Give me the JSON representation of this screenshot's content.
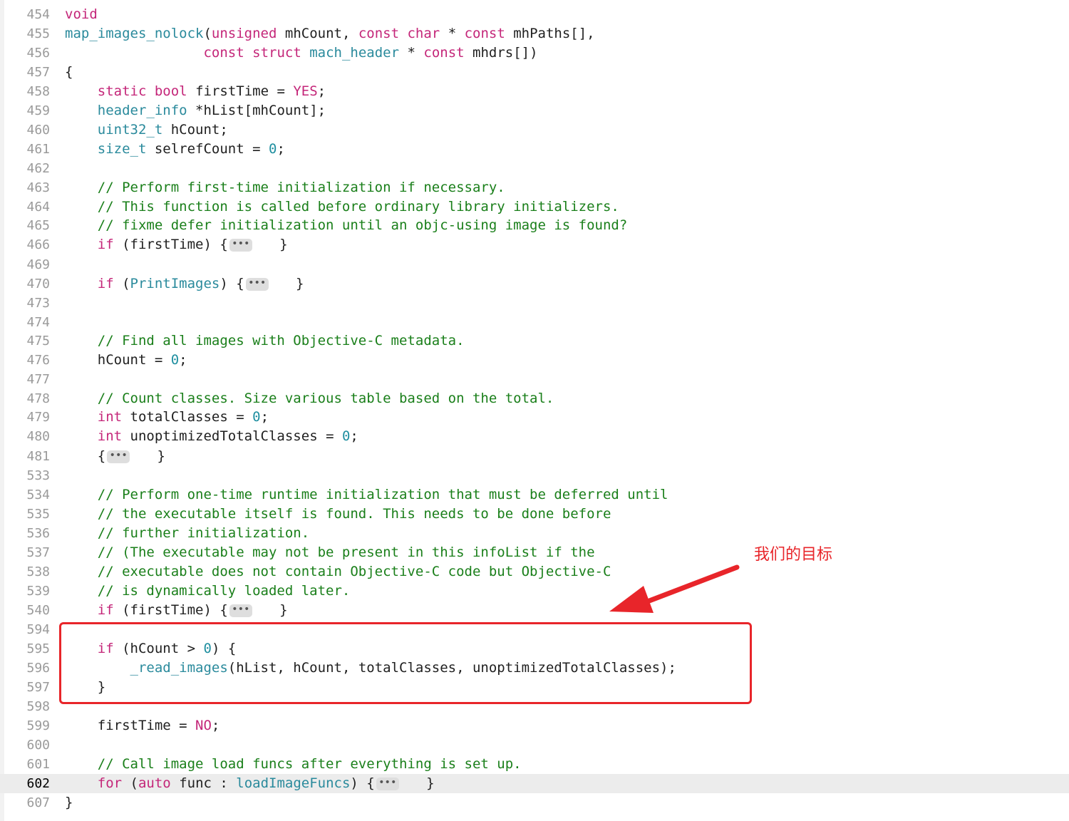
{
  "editor": {
    "current_line": "602",
    "lines": [
      {
        "ln": "454",
        "tokens": [
          {
            "t": "void",
            "c": "kw"
          }
        ]
      },
      {
        "ln": "455",
        "tokens": [
          {
            "t": "map_images_nolock",
            "c": "ty"
          },
          {
            "t": "(",
            "c": "pl"
          },
          {
            "t": "unsigned",
            "c": "kw"
          },
          {
            "t": " mhCount, ",
            "c": "pl"
          },
          {
            "t": "const",
            "c": "kw"
          },
          {
            "t": " ",
            "c": "pl"
          },
          {
            "t": "char",
            "c": "kw"
          },
          {
            "t": " * ",
            "c": "pl"
          },
          {
            "t": "const",
            "c": "kw"
          },
          {
            "t": " mhPaths[],",
            "c": "pl"
          }
        ]
      },
      {
        "ln": "456",
        "tokens": [
          {
            "t": "                 ",
            "c": "pl"
          },
          {
            "t": "const",
            "c": "kw"
          },
          {
            "t": " ",
            "c": "pl"
          },
          {
            "t": "struct",
            "c": "kw"
          },
          {
            "t": " ",
            "c": "pl"
          },
          {
            "t": "mach_header",
            "c": "ty"
          },
          {
            "t": " * ",
            "c": "pl"
          },
          {
            "t": "const",
            "c": "kw"
          },
          {
            "t": " mhdrs[])",
            "c": "pl"
          }
        ]
      },
      {
        "ln": "457",
        "tokens": [
          {
            "t": "{",
            "c": "pl"
          }
        ]
      },
      {
        "ln": "458",
        "tokens": [
          {
            "t": "    ",
            "c": "pl"
          },
          {
            "t": "static",
            "c": "kw"
          },
          {
            "t": " ",
            "c": "pl"
          },
          {
            "t": "bool",
            "c": "kw"
          },
          {
            "t": " firstTime = ",
            "c": "pl"
          },
          {
            "t": "YES",
            "c": "kw"
          },
          {
            "t": ";",
            "c": "pl"
          }
        ]
      },
      {
        "ln": "459",
        "tokens": [
          {
            "t": "    ",
            "c": "pl"
          },
          {
            "t": "header_info",
            "c": "ty"
          },
          {
            "t": " *hList[mhCount];",
            "c": "pl"
          }
        ]
      },
      {
        "ln": "460",
        "tokens": [
          {
            "t": "    ",
            "c": "pl"
          },
          {
            "t": "uint32_t",
            "c": "ty"
          },
          {
            "t": " hCount;",
            "c": "pl"
          }
        ]
      },
      {
        "ln": "461",
        "tokens": [
          {
            "t": "    ",
            "c": "pl"
          },
          {
            "t": "size_t",
            "c": "ty"
          },
          {
            "t": " selrefCount = ",
            "c": "pl"
          },
          {
            "t": "0",
            "c": "num"
          },
          {
            "t": ";",
            "c": "pl"
          }
        ]
      },
      {
        "ln": "462",
        "tokens": []
      },
      {
        "ln": "463",
        "tokens": [
          {
            "t": "    // Perform first-time initialization if necessary.",
            "c": "cm"
          }
        ]
      },
      {
        "ln": "464",
        "tokens": [
          {
            "t": "    // This function is called before ordinary library initializers.",
            "c": "cm"
          }
        ]
      },
      {
        "ln": "465",
        "tokens": [
          {
            "t": "    // fixme defer initialization until an objc-using image is found?",
            "c": "cm"
          }
        ]
      },
      {
        "ln": "466",
        "tokens": [
          {
            "t": "    ",
            "c": "pl"
          },
          {
            "t": "if",
            "c": "kw"
          },
          {
            "t": " (firstTime) {",
            "c": "pl"
          },
          {
            "t": "•••",
            "c": "fold"
          },
          {
            "t": "   }",
            "c": "pl"
          }
        ]
      },
      {
        "ln": "469",
        "tokens": []
      },
      {
        "ln": "470",
        "tokens": [
          {
            "t": "    ",
            "c": "pl"
          },
          {
            "t": "if",
            "c": "kw"
          },
          {
            "t": " (",
            "c": "pl"
          },
          {
            "t": "PrintImages",
            "c": "ty"
          },
          {
            "t": ") {",
            "c": "pl"
          },
          {
            "t": "•••",
            "c": "fold"
          },
          {
            "t": "   }",
            "c": "pl"
          }
        ]
      },
      {
        "ln": "473",
        "tokens": []
      },
      {
        "ln": "474",
        "tokens": []
      },
      {
        "ln": "475",
        "tokens": [
          {
            "t": "    // Find all images with Objective-C metadata.",
            "c": "cm"
          }
        ]
      },
      {
        "ln": "476",
        "tokens": [
          {
            "t": "    hCount = ",
            "c": "pl"
          },
          {
            "t": "0",
            "c": "num"
          },
          {
            "t": ";",
            "c": "pl"
          }
        ]
      },
      {
        "ln": "477",
        "tokens": []
      },
      {
        "ln": "478",
        "tokens": [
          {
            "t": "    // Count classes. Size various table based on the total.",
            "c": "cm"
          }
        ]
      },
      {
        "ln": "479",
        "tokens": [
          {
            "t": "    ",
            "c": "pl"
          },
          {
            "t": "int",
            "c": "kw"
          },
          {
            "t": " totalClasses = ",
            "c": "pl"
          },
          {
            "t": "0",
            "c": "num"
          },
          {
            "t": ";",
            "c": "pl"
          }
        ]
      },
      {
        "ln": "480",
        "tokens": [
          {
            "t": "    ",
            "c": "pl"
          },
          {
            "t": "int",
            "c": "kw"
          },
          {
            "t": " unoptimizedTotalClasses = ",
            "c": "pl"
          },
          {
            "t": "0",
            "c": "num"
          },
          {
            "t": ";",
            "c": "pl"
          }
        ]
      },
      {
        "ln": "481",
        "tokens": [
          {
            "t": "    {",
            "c": "pl"
          },
          {
            "t": "•••",
            "c": "fold"
          },
          {
            "t": "   }",
            "c": "pl"
          }
        ]
      },
      {
        "ln": "533",
        "tokens": []
      },
      {
        "ln": "534",
        "tokens": [
          {
            "t": "    // Perform one-time runtime initialization that must be deferred until",
            "c": "cm"
          }
        ]
      },
      {
        "ln": "535",
        "tokens": [
          {
            "t": "    // the executable itself is found. This needs to be done before",
            "c": "cm"
          }
        ]
      },
      {
        "ln": "536",
        "tokens": [
          {
            "t": "    // further initialization.",
            "c": "cm"
          }
        ]
      },
      {
        "ln": "537",
        "tokens": [
          {
            "t": "    // (The executable may not be present in this infoList if the",
            "c": "cm"
          }
        ]
      },
      {
        "ln": "538",
        "tokens": [
          {
            "t": "    // executable does not contain Objective-C code but Objective-C",
            "c": "cm"
          }
        ]
      },
      {
        "ln": "539",
        "tokens": [
          {
            "t": "    // is dynamically loaded later.",
            "c": "cm"
          }
        ]
      },
      {
        "ln": "540",
        "tokens": [
          {
            "t": "    ",
            "c": "pl"
          },
          {
            "t": "if",
            "c": "kw"
          },
          {
            "t": " (firstTime) {",
            "c": "pl"
          },
          {
            "t": "•••",
            "c": "fold"
          },
          {
            "t": "   }",
            "c": "pl"
          }
        ]
      },
      {
        "ln": "594",
        "tokens": []
      },
      {
        "ln": "595",
        "tokens": [
          {
            "t": "    ",
            "c": "pl"
          },
          {
            "t": "if",
            "c": "kw"
          },
          {
            "t": " (hCount > ",
            "c": "pl"
          },
          {
            "t": "0",
            "c": "num"
          },
          {
            "t": ") {",
            "c": "pl"
          }
        ]
      },
      {
        "ln": "596",
        "tokens": [
          {
            "t": "        ",
            "c": "pl"
          },
          {
            "t": "_read_images",
            "c": "ty"
          },
          {
            "t": "(hList, hCount, totalClasses, unoptimizedTotalClasses);",
            "c": "pl"
          }
        ]
      },
      {
        "ln": "597",
        "tokens": [
          {
            "t": "    }",
            "c": "pl"
          }
        ]
      },
      {
        "ln": "598",
        "tokens": []
      },
      {
        "ln": "599",
        "tokens": [
          {
            "t": "    firstTime = ",
            "c": "pl"
          },
          {
            "t": "NO",
            "c": "kw"
          },
          {
            "t": ";",
            "c": "pl"
          }
        ]
      },
      {
        "ln": "600",
        "tokens": []
      },
      {
        "ln": "601",
        "tokens": [
          {
            "t": "    // Call image load funcs after everything is set up.",
            "c": "cm"
          }
        ]
      },
      {
        "ln": "602",
        "tokens": [
          {
            "t": "    ",
            "c": "pl"
          },
          {
            "t": "for",
            "c": "kw"
          },
          {
            "t": " (",
            "c": "pl"
          },
          {
            "t": "auto",
            "c": "kw"
          },
          {
            "t": " func : ",
            "c": "pl"
          },
          {
            "t": "loadImageFuncs",
            "c": "ty"
          },
          {
            "t": ") {",
            "c": "pl"
          },
          {
            "t": "•••",
            "c": "fold"
          },
          {
            "t": "   }",
            "c": "pl"
          }
        ]
      },
      {
        "ln": "607",
        "tokens": [
          {
            "t": "}",
            "c": "pl"
          }
        ]
      }
    ]
  },
  "annotation": {
    "label": "我们的目标",
    "color": "#e8252a"
  },
  "colors": {
    "keyword": "#c42679",
    "type": "#2a8a9c",
    "number": "#1f8fa0",
    "comment": "#1a7f1a",
    "plain": "#1f1f1f",
    "line_number": "#9a9a9a",
    "current_line_bg": "#ececec"
  }
}
